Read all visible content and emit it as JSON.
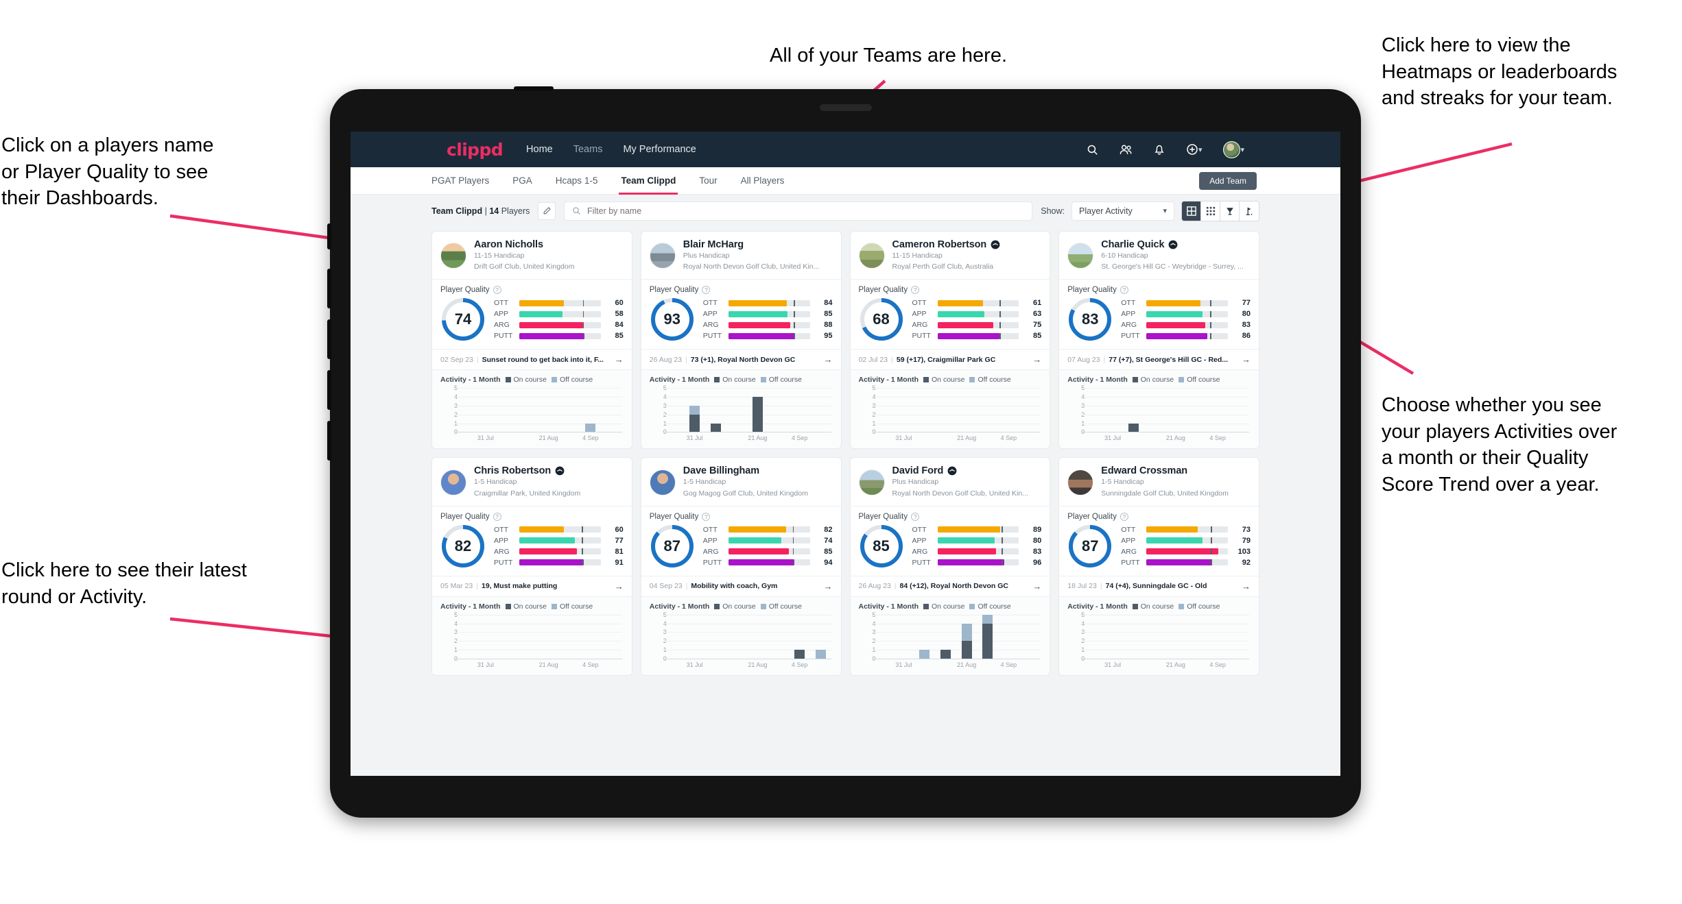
{
  "annotations": {
    "top_left": "Click on a players name\nor Player Quality to see\ntheir Dashboards.",
    "bottom_left": "Click here to see their latest\nround or Activity.",
    "top_center": "All of your Teams are here.",
    "top_right": "Click here to view the\nHeatmaps or leaderboards\nand streaks for your team.",
    "bottom_right": "Choose whether you see\nyour players Activities over\na month or their Quality\nScore Trend over a year."
  },
  "topnav": {
    "brand": "clippd",
    "links": [
      {
        "label": "Home",
        "active": true
      },
      {
        "label": "Teams",
        "active": false
      },
      {
        "label": "My Performance",
        "active": true
      }
    ],
    "icons": [
      "search-icon",
      "people-icon",
      "bell-icon",
      "plus-circle-icon",
      "avatar"
    ]
  },
  "subtabs": {
    "items": [
      {
        "label": "PGAT Players",
        "active": false
      },
      {
        "label": "PGA",
        "active": false
      },
      {
        "label": "Hcaps 1-5",
        "active": false
      },
      {
        "label": "Team Clippd",
        "active": true
      },
      {
        "label": "Tour",
        "active": false
      },
      {
        "label": "All Players",
        "active": false
      }
    ],
    "add_team_label": "Add Team"
  },
  "toolbar": {
    "team_name": "Team Clippd",
    "separator": "|",
    "player_count": "14",
    "players_word": "Players",
    "edit_icon": "pencil-icon",
    "search_placeholder": "Filter by name",
    "show_label": "Show:",
    "show_value": "Player Activity",
    "view_buttons": [
      {
        "name": "grid-view-icon",
        "selected": true
      },
      {
        "name": "dense-grid-view-icon",
        "selected": false
      },
      {
        "name": "heatmap-trophy-icon",
        "selected": false
      },
      {
        "name": "golf-flag-icon",
        "selected": false
      }
    ]
  },
  "card_labels": {
    "player_quality": "Player Quality",
    "help_icon": "question-mark-icon",
    "activity_title": "Activity - 1 Month",
    "legend_on": "On course",
    "legend_off": "Off course",
    "arrow_icon": "arrow-right-icon"
  },
  "colors": {
    "brand_pink": "#ec2d64",
    "nav_dark": "#1b2a38",
    "donut_blue": "#1a73c4",
    "ott": "#f5a800",
    "app": "#3ad6ae",
    "arg": "#f5225f",
    "putt": "#a913c9",
    "on_course": "#4e5c68",
    "off_course": "#9db6cb"
  },
  "chart_data": {
    "type": "bar",
    "title": "Activity - 1 Month",
    "ylabel": "",
    "ylim": [
      0,
      5
    ],
    "yticks": [
      0,
      1,
      2,
      3,
      4,
      5
    ],
    "xticks": [
      "31 Jul",
      "21 Aug",
      "4 Sep"
    ],
    "grid": true,
    "legend": [
      "On course",
      "Off course"
    ],
    "stacked": true
  },
  "players": [
    {
      "name": "Aaron Nicholls",
      "verified": false,
      "avatar_class": "pv1",
      "handicap": "11-15 Handicap",
      "club": "Drift Golf Club, United Kingdom",
      "quality": 74,
      "metrics": [
        {
          "label": "OTT",
          "value": 60,
          "fill": 55,
          "tick": 78,
          "color": "#f5a800"
        },
        {
          "label": "APP",
          "value": 58,
          "fill": 53,
          "tick": 78,
          "color": "#3ad6ae"
        },
        {
          "label": "ARG",
          "value": 84,
          "fill": 78,
          "tick": 78,
          "color": "#f5225f"
        },
        {
          "label": "PUTT",
          "value": 85,
          "fill": 80,
          "tick": 78,
          "color": "#a913c9"
        }
      ],
      "latest_date": "02 Sep 23",
      "latest_text": "Sunset round to get back into it, F...",
      "activity": [
        {
          "on": 0,
          "off": 0
        },
        {
          "on": 0,
          "off": 0
        },
        {
          "on": 0,
          "off": 0
        },
        {
          "on": 0,
          "off": 0
        },
        {
          "on": 0,
          "off": 0
        },
        {
          "on": 0,
          "off": 0
        },
        {
          "on": 0,
          "off": 1
        },
        {
          "on": 0,
          "off": 0
        }
      ]
    },
    {
      "name": "Blair McHarg",
      "verified": false,
      "avatar_class": "pv2",
      "handicap": "Plus Handicap",
      "club": "Royal North Devon Golf Club, United Kin...",
      "quality": 93,
      "metrics": [
        {
          "label": "OTT",
          "value": 84,
          "fill": 72,
          "tick": 80,
          "color": "#f5a800"
        },
        {
          "label": "APP",
          "value": 85,
          "fill": 73,
          "tick": 80,
          "color": "#3ad6ae"
        },
        {
          "label": "ARG",
          "value": 88,
          "fill": 76,
          "tick": 80,
          "color": "#f5225f"
        },
        {
          "label": "PUTT",
          "value": 95,
          "fill": 82,
          "tick": 80,
          "color": "#a913c9"
        }
      ],
      "latest_date": "26 Aug 23",
      "latest_text": "73 (+1), Royal North Devon GC",
      "activity": [
        {
          "on": 0,
          "off": 0
        },
        {
          "on": 2,
          "off": 1
        },
        {
          "on": 1,
          "off": 0
        },
        {
          "on": 0,
          "off": 0
        },
        {
          "on": 4,
          "off": 0
        },
        {
          "on": 0,
          "off": 0
        },
        {
          "on": 0,
          "off": 0
        },
        {
          "on": 0,
          "off": 0
        }
      ]
    },
    {
      "name": "Cameron Robertson",
      "verified": true,
      "avatar_class": "pv3",
      "handicap": "11-15 Handicap",
      "club": "Royal Perth Golf Club, Australia",
      "quality": 68,
      "metrics": [
        {
          "label": "OTT",
          "value": 61,
          "fill": 56,
          "tick": 76,
          "color": "#f5a800"
        },
        {
          "label": "APP",
          "value": 63,
          "fill": 58,
          "tick": 76,
          "color": "#3ad6ae"
        },
        {
          "label": "ARG",
          "value": 75,
          "fill": 69,
          "tick": 76,
          "color": "#f5225f"
        },
        {
          "label": "PUTT",
          "value": 85,
          "fill": 76,
          "tick": 76,
          "color": "#a913c9"
        }
      ],
      "latest_date": "02 Jul 23",
      "latest_text": "59 (+17), Craigmillar Park GC",
      "activity": [
        {
          "on": 0,
          "off": 0
        },
        {
          "on": 0,
          "off": 0
        },
        {
          "on": 0,
          "off": 0
        },
        {
          "on": 0,
          "off": 0
        },
        {
          "on": 0,
          "off": 0
        },
        {
          "on": 0,
          "off": 0
        },
        {
          "on": 0,
          "off": 0
        },
        {
          "on": 0,
          "off": 0
        }
      ]
    },
    {
      "name": "Charlie Quick",
      "verified": true,
      "avatar_class": "pv4",
      "handicap": "6-10 Handicap",
      "club": "St. George's Hill GC - Weybridge - Surrey, ...",
      "quality": 83,
      "metrics": [
        {
          "label": "OTT",
          "value": 77,
          "fill": 66,
          "tick": 78,
          "color": "#f5a800"
        },
        {
          "label": "APP",
          "value": 80,
          "fill": 69,
          "tick": 78,
          "color": "#3ad6ae"
        },
        {
          "label": "ARG",
          "value": 83,
          "fill": 72,
          "tick": 78,
          "color": "#f5225f"
        },
        {
          "label": "PUTT",
          "value": 86,
          "fill": 75,
          "tick": 78,
          "color": "#a913c9"
        }
      ],
      "latest_date": "07 Aug 23",
      "latest_text": "77 (+7), St George's Hill GC - Red...",
      "activity": [
        {
          "on": 0,
          "off": 0
        },
        {
          "on": 0,
          "off": 0
        },
        {
          "on": 1,
          "off": 0
        },
        {
          "on": 0,
          "off": 0
        },
        {
          "on": 0,
          "off": 0
        },
        {
          "on": 0,
          "off": 0
        },
        {
          "on": 0,
          "off": 0
        },
        {
          "on": 0,
          "off": 0
        }
      ]
    },
    {
      "name": "Chris Robertson",
      "verified": true,
      "avatar_class": "pv5",
      "handicap": "1-5 Handicap",
      "club": "Craigmillar Park, United Kingdom",
      "quality": 82,
      "metrics": [
        {
          "label": "OTT",
          "value": 60,
          "fill": 55,
          "tick": 77,
          "color": "#f5a800"
        },
        {
          "label": "APP",
          "value": 77,
          "fill": 68,
          "tick": 77,
          "color": "#3ad6ae"
        },
        {
          "label": "ARG",
          "value": 81,
          "fill": 71,
          "tick": 77,
          "color": "#f5225f"
        },
        {
          "label": "PUTT",
          "value": 91,
          "fill": 79,
          "tick": 77,
          "color": "#a913c9"
        }
      ],
      "latest_date": "05 Mar 23",
      "latest_text": "19, Must make putting",
      "activity": [
        {
          "on": 0,
          "off": 0
        },
        {
          "on": 0,
          "off": 0
        },
        {
          "on": 0,
          "off": 0
        },
        {
          "on": 0,
          "off": 0
        },
        {
          "on": 0,
          "off": 0
        },
        {
          "on": 0,
          "off": 0
        },
        {
          "on": 0,
          "off": 0
        },
        {
          "on": 0,
          "off": 0
        }
      ]
    },
    {
      "name": "Dave Billingham",
      "verified": false,
      "avatar_class": "pv6",
      "handicap": "1-5 Handicap",
      "club": "Gog Magog Golf Club, United Kingdom",
      "quality": 87,
      "metrics": [
        {
          "label": "OTT",
          "value": 82,
          "fill": 71,
          "tick": 79,
          "color": "#f5a800"
        },
        {
          "label": "APP",
          "value": 74,
          "fill": 65,
          "tick": 79,
          "color": "#3ad6ae"
        },
        {
          "label": "ARG",
          "value": 85,
          "fill": 74,
          "tick": 79,
          "color": "#f5225f"
        },
        {
          "label": "PUTT",
          "value": 94,
          "fill": 81,
          "tick": 79,
          "color": "#a913c9"
        }
      ],
      "latest_date": "04 Sep 23",
      "latest_text": "Mobility with coach, Gym",
      "activity": [
        {
          "on": 0,
          "off": 0
        },
        {
          "on": 0,
          "off": 0
        },
        {
          "on": 0,
          "off": 0
        },
        {
          "on": 0,
          "off": 0
        },
        {
          "on": 0,
          "off": 0
        },
        {
          "on": 0,
          "off": 0
        },
        {
          "on": 1,
          "off": 0
        },
        {
          "on": 0,
          "off": 1
        }
      ]
    },
    {
      "name": "David Ford",
      "verified": true,
      "avatar_class": "pv7",
      "handicap": "Plus Handicap",
      "club": "Royal North Devon Golf Club, United Kin...",
      "quality": 85,
      "metrics": [
        {
          "label": "OTT",
          "value": 89,
          "fill": 77,
          "tick": 79,
          "color": "#f5a800"
        },
        {
          "label": "APP",
          "value": 80,
          "fill": 70,
          "tick": 79,
          "color": "#3ad6ae"
        },
        {
          "label": "ARG",
          "value": 83,
          "fill": 72,
          "tick": 79,
          "color": "#f5225f"
        },
        {
          "label": "PUTT",
          "value": 96,
          "fill": 82,
          "tick": 79,
          "color": "#a913c9"
        }
      ],
      "latest_date": "26 Aug 23",
      "latest_text": "84 (+12), Royal North Devon GC",
      "activity": [
        {
          "on": 0,
          "off": 0
        },
        {
          "on": 0,
          "off": 0
        },
        {
          "on": 0,
          "off": 1
        },
        {
          "on": 1,
          "off": 0
        },
        {
          "on": 2,
          "off": 2
        },
        {
          "on": 4,
          "off": 1
        },
        {
          "on": 0,
          "off": 0
        },
        {
          "on": 0,
          "off": 0
        }
      ]
    },
    {
      "name": "Edward Crossman",
      "verified": false,
      "avatar_class": "pv8",
      "handicap": "1-5 Handicap",
      "club": "Sunningdale Golf Club, United Kingdom",
      "quality": 87,
      "metrics": [
        {
          "label": "OTT",
          "value": 73,
          "fill": 63,
          "tick": 79,
          "color": "#f5a800"
        },
        {
          "label": "APP",
          "value": 79,
          "fill": 69,
          "tick": 79,
          "color": "#3ad6ae"
        },
        {
          "label": "ARG",
          "value": 103,
          "fill": 88,
          "tick": 79,
          "color": "#f5225f"
        },
        {
          "label": "PUTT",
          "value": 92,
          "fill": 80,
          "tick": 79,
          "color": "#a913c9"
        }
      ],
      "latest_date": "18 Jul 23",
      "latest_text": "74 (+4), Sunningdale GC - Old",
      "activity": [
        {
          "on": 0,
          "off": 0
        },
        {
          "on": 0,
          "off": 0
        },
        {
          "on": 0,
          "off": 0
        },
        {
          "on": 0,
          "off": 0
        },
        {
          "on": 0,
          "off": 0
        },
        {
          "on": 0,
          "off": 0
        },
        {
          "on": 0,
          "off": 0
        },
        {
          "on": 0,
          "off": 0
        }
      ]
    }
  ]
}
